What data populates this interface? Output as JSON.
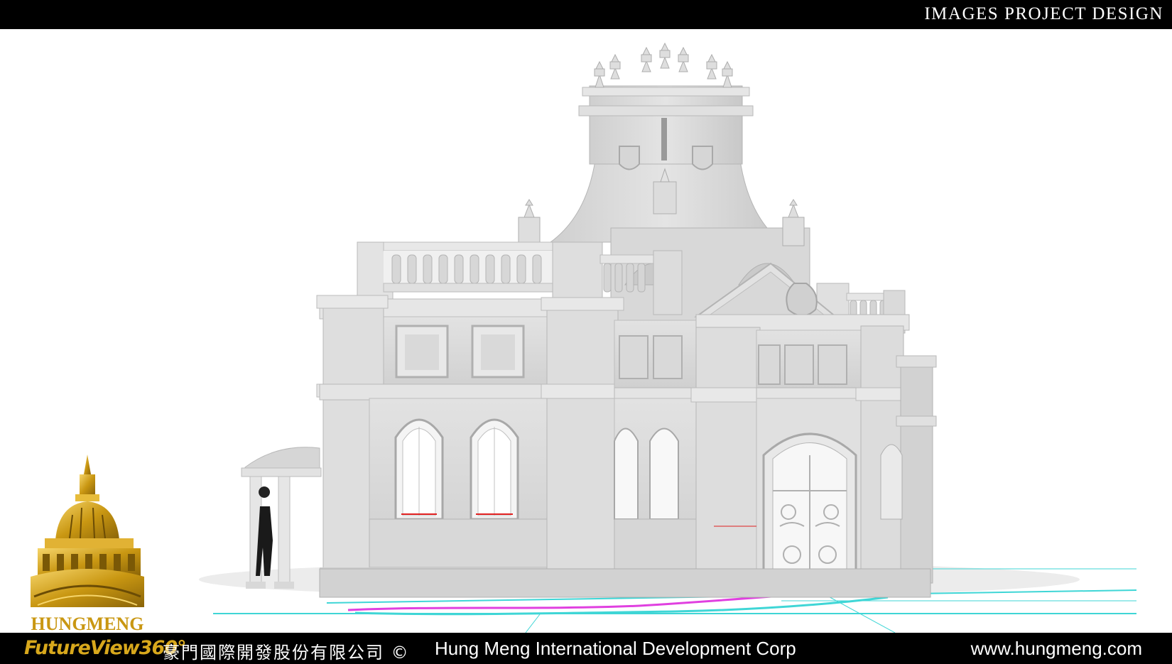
{
  "header": {
    "title": "IMAGES PROJECT DESIGN"
  },
  "footer": {
    "brand": "FutureView360°",
    "company_cn": "豪門國際開發股份有限公司 ©",
    "company_en": "Hung Meng International Development Corp",
    "website": "www.hungmeng.com"
  },
  "logo": {
    "wordmark": "HUNGMENG",
    "icon": "gold-dome-icon"
  },
  "render": {
    "subject": "building-render",
    "colors": {
      "wall": "#dcdcdc",
      "wall_shadow": "#bdbdbd",
      "trim": "#e9e9e9",
      "gold": "#c99712",
      "guide_cyan": "#3fd6d6",
      "guide_magenta": "#e040e0",
      "guide_red": "#e02020"
    }
  }
}
